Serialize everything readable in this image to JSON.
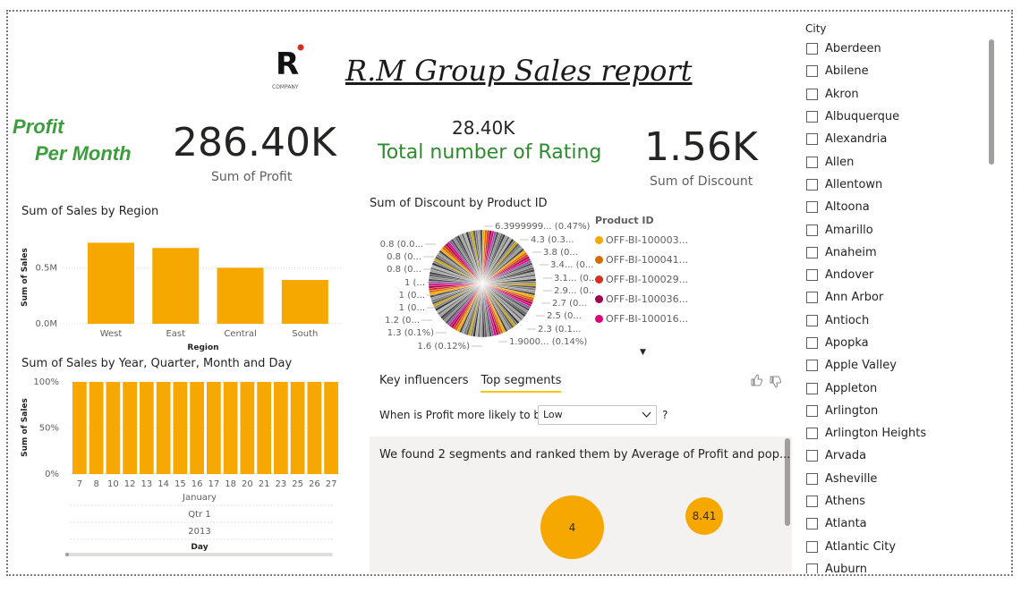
{
  "report": {
    "title": "R.M Group Sales report",
    "logo_text": "R",
    "logo_caption": "COMPANY"
  },
  "kpis": {
    "profit_label_line1": "Profit",
    "profit_label_line2": "Per Month",
    "profit_value": "286.40K",
    "profit_caption": "Sum of Profit",
    "rating_value": "28.40K",
    "rating_caption": "Total number of Rating",
    "discount_value": "1.56K",
    "discount_caption": "Sum of Discount"
  },
  "colors": {
    "bar": "#f7a800",
    "green": "#3d9c3d"
  },
  "chart_data": [
    {
      "type": "bar",
      "title": "Sum of Sales by Region",
      "xlabel": "Region",
      "ylabel": "Sum of Sales",
      "categories": [
        "West",
        "East",
        "Central",
        "South"
      ],
      "values": [
        0.725,
        0.678,
        0.501,
        0.392
      ],
      "ylim": [
        0,
        0.8
      ],
      "yticks": [
        "0.0M",
        "0.5M"
      ],
      "grid": true
    },
    {
      "type": "bar",
      "title": "Sum of Sales by Year, Quarter, Month and Day",
      "xlabel": "Day",
      "ylabel": "Sum of Sales",
      "categories": [
        "7",
        "8",
        "10",
        "12",
        "13",
        "14",
        "15",
        "16",
        "17",
        "18",
        "20",
        "21",
        "23",
        "25",
        "26",
        "27"
      ],
      "values": [
        100,
        100,
        100,
        100,
        100,
        100,
        100,
        100,
        100,
        100,
        100,
        100,
        100,
        100,
        100,
        100
      ],
      "ylim": [
        0,
        100
      ],
      "yticks": [
        "0%",
        "50%",
        "100%"
      ],
      "hierarchy": [
        "January",
        "Qtr 1",
        "2013"
      ],
      "grid": true
    },
    {
      "type": "pie",
      "title": "Sum of Discount by Product ID",
      "legend_title": "Product ID",
      "slice_labels_left": [
        "0.8 (0.0...",
        "0.8 (0...",
        "0.8 (0...",
        "1 (...",
        "1 (0...",
        "1 (0...",
        "1.2 (0...",
        "1.3 (0.1%)",
        "1.6 (0.12%)"
      ],
      "slice_labels_right": [
        "6.3999999... (0.47%)",
        "4.3 (0.3...",
        "3.8 (0...",
        "3.4... (0...",
        "3.1... (0...",
        "2.9... (0...",
        "2.7 (0...",
        "2.5 (0...",
        "2.3 (0.1...",
        "1.9000... (0.14%)"
      ],
      "legend": [
        {
          "name": "OFF-BI-100003...",
          "color": "#f7a800"
        },
        {
          "name": "OFF-BI-100041...",
          "color": "#d36f00"
        },
        {
          "name": "OFF-BI-100029...",
          "color": "#d62e1f"
        },
        {
          "name": "OFF-BI-100036...",
          "color": "#a3004d"
        },
        {
          "name": "OFF-BI-100016...",
          "color": "#e0007a"
        }
      ]
    }
  ],
  "influencers": {
    "tab1": "Key influencers",
    "tab2": "Top segments",
    "question": "When is Profit more likely to be",
    "dropdown_value": "Low",
    "help": "?",
    "summary": "We found 2 segments and ranked them by Average of Profit and pop...",
    "bubble1": "4",
    "bubble2": "8.41"
  },
  "slicer": {
    "title": "City",
    "items": [
      "Aberdeen",
      "Abilene",
      "Akron",
      "Albuquerque",
      "Alexandria",
      "Allen",
      "Allentown",
      "Altoona",
      "Amarillo",
      "Anaheim",
      "Andover",
      "Ann Arbor",
      "Antioch",
      "Apopka",
      "Apple Valley",
      "Appleton",
      "Arlington",
      "Arlington Heights",
      "Arvada",
      "Asheville",
      "Athens",
      "Atlanta",
      "Atlantic City",
      "Auburn"
    ]
  }
}
